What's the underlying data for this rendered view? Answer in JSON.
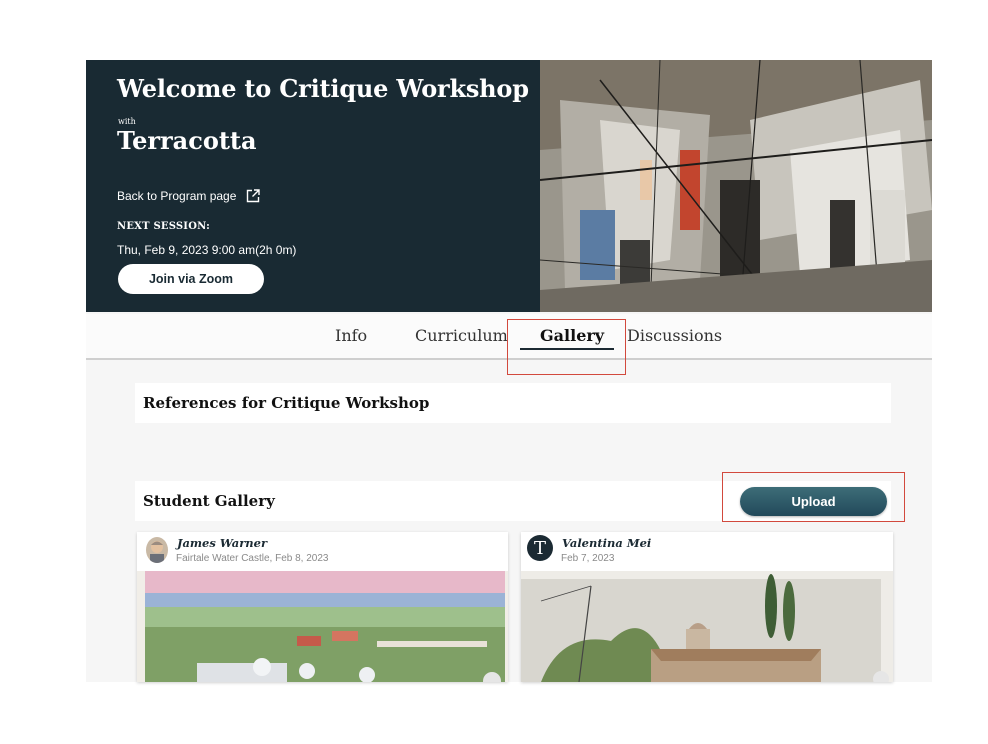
{
  "hero": {
    "title": "Welcome to Critique Workshop",
    "with_label": "with",
    "instructor": "Terracotta",
    "back_link": "Back to Program page",
    "next_session_label": "Next session:",
    "next_session_time": "Thu, Feb 9, 2023 9:00 am(2h 0m)",
    "join_button": "Join via Zoom"
  },
  "tabs": [
    {
      "label": "Info",
      "active": false
    },
    {
      "label": "Curriculum",
      "active": false
    },
    {
      "label": "Gallery",
      "active": true
    },
    {
      "label": "Discussions",
      "active": false
    }
  ],
  "references": {
    "title": "References for Critique Workshop"
  },
  "gallery": {
    "title": "Student Gallery",
    "upload_button": "Upload",
    "posts": [
      {
        "author": "James Warner",
        "meta": "Fairtale Water Castle, Feb 8, 2023"
      },
      {
        "author": "Valentina Mei",
        "avatar_letter": "T",
        "meta": "Feb 7, 2023"
      }
    ]
  },
  "colors": {
    "hero_bg": "#192a33",
    "highlight": "#d2493d",
    "upload_bg": "#2f5d6b"
  }
}
